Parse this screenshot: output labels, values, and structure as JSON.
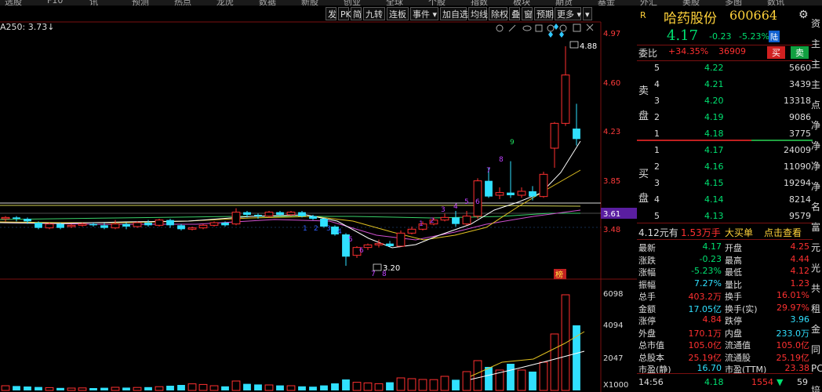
{
  "topnav": [
    "选股",
    "F10",
    "讯",
    "预测",
    "热点",
    "龙虎",
    "数据",
    "新股",
    "创业",
    "全球",
    "个股",
    "指数",
    "板块",
    "期货",
    "基金",
    "外汇",
    "美股",
    "多图",
    "数讯"
  ],
  "toolbar": [
    "发",
    "PK",
    "简",
    "九转",
    "连板",
    "事件 ▾",
    "加自选",
    "均线",
    "除权",
    "叠",
    "窗",
    "预期",
    "更多 ▾"
  ],
  "ma_label": "A250: 3.73↓",
  "price_scale": [
    "4.97",
    "4.60",
    "4.23",
    "3.85",
    "3.48"
  ],
  "volume_scale": [
    "6098",
    "4094",
    "2047",
    "X1000"
  ],
  "current_price_tag": "3.61",
  "annotations": {
    "high": "4.88",
    "low": "3.20",
    "rank_tag": "榜"
  },
  "stock": {
    "market_flag": "R",
    "name": "哈药股份",
    "code": "600664",
    "price": "4.17",
    "change": "-0.23",
    "pct": "-5.23%",
    "exchange": "陆"
  },
  "weibi": {
    "label": "委比",
    "pct": "+34.35%",
    "diff": "36909",
    "buy_btn": "买",
    "sell_btn": "卖"
  },
  "sell_side_label": [
    "卖",
    "盘"
  ],
  "buy_side_label": [
    "买",
    "盘"
  ],
  "asks": [
    {
      "level": "5",
      "price": "4.22",
      "vol": "5660"
    },
    {
      "level": "4",
      "price": "4.21",
      "vol": "3439"
    },
    {
      "level": "3",
      "price": "4.20",
      "vol": "13318"
    },
    {
      "level": "2",
      "price": "4.19",
      "vol": "9086"
    },
    {
      "level": "1",
      "price": "4.18",
      "vol": "3775"
    }
  ],
  "bids": [
    {
      "level": "1",
      "price": "4.17",
      "vol": "24009"
    },
    {
      "level": "2",
      "price": "4.16",
      "vol": "11090"
    },
    {
      "level": "3",
      "price": "4.15",
      "vol": "19294"
    },
    {
      "level": "4",
      "price": "4.14",
      "vol": "8214"
    },
    {
      "level": "5",
      "price": "4.13",
      "vol": "9579"
    }
  ],
  "big_order": {
    "price": "4.12元有",
    "amount": "1.53万手",
    "type": "大买单",
    "action": "点击查看"
  },
  "stats": [
    [
      "最新",
      "4.17",
      "开盘",
      "4.25"
    ],
    [
      "涨跌",
      "-0.23",
      "最高",
      "4.44"
    ],
    [
      "涨幅",
      "-5.23%",
      "最低",
      "4.12"
    ],
    [
      "振幅",
      "7.27%",
      "量比",
      "1.23"
    ],
    [
      "总手",
      "403.2万",
      "换手",
      "16.01%"
    ],
    [
      "金额",
      "17.05亿",
      "换手(实)",
      "29.97%"
    ],
    [
      "涨停",
      "4.84",
      "跌停",
      "3.96"
    ],
    [
      "外盘",
      "170.1万",
      "内盘",
      "233.0万"
    ],
    [
      "总市值",
      "105.0亿",
      "流通值",
      "105.0亿"
    ],
    [
      "总股本",
      "25.19亿",
      "流通股",
      "25.19亿"
    ],
    [
      "市盈(静)",
      "16.70",
      "市盈(TTM)",
      "23.38"
    ]
  ],
  "tick": {
    "time": "14:56",
    "price": "4.18",
    "vol": "1554",
    "count": "59"
  },
  "farright": [
    "资",
    "主",
    "主",
    "主",
    "点",
    "净",
    "净",
    "净",
    "净",
    "名",
    "富",
    "元",
    "光",
    "共",
    "租",
    "金",
    "同",
    "PC",
    "培"
  ],
  "chart_data": {
    "type": "candlestick",
    "price_ylim": [
      3.2,
      4.97
    ],
    "volume_ylim": [
      0,
      6098
    ],
    "candles": [
      {
        "o": 3.56,
        "c": 3.57,
        "h": 3.58,
        "l": 3.54
      },
      {
        "o": 3.57,
        "c": 3.56,
        "h": 3.58,
        "l": 3.54
      },
      {
        "o": 3.56,
        "c": 3.54,
        "h": 3.57,
        "l": 3.52
      },
      {
        "o": 3.53,
        "c": 3.49,
        "h": 3.54,
        "l": 3.48
      },
      {
        "o": 3.49,
        "c": 3.52,
        "h": 3.53,
        "l": 3.48
      },
      {
        "o": 3.52,
        "c": 3.49,
        "h": 3.53,
        "l": 3.48
      },
      {
        "o": 3.5,
        "c": 3.51,
        "h": 3.52,
        "l": 3.49
      },
      {
        "o": 3.51,
        "c": 3.52,
        "h": 3.53,
        "l": 3.5
      },
      {
        "o": 3.52,
        "c": 3.51,
        "h": 3.53,
        "l": 3.5
      },
      {
        "o": 3.51,
        "c": 3.49,
        "h": 3.53,
        "l": 3.48
      },
      {
        "o": 3.49,
        "c": 3.52,
        "h": 3.55,
        "l": 3.48
      },
      {
        "o": 3.52,
        "c": 3.5,
        "h": 3.53,
        "l": 3.48
      },
      {
        "o": 3.5,
        "c": 3.53,
        "h": 3.54,
        "l": 3.49
      },
      {
        "o": 3.53,
        "c": 3.51,
        "h": 3.55,
        "l": 3.5
      },
      {
        "o": 3.51,
        "c": 3.55,
        "h": 3.56,
        "l": 3.5
      },
      {
        "o": 3.55,
        "c": 3.51,
        "h": 3.56,
        "l": 3.49
      },
      {
        "o": 3.51,
        "c": 3.48,
        "h": 3.52,
        "l": 3.47
      },
      {
        "o": 3.48,
        "c": 3.49,
        "h": 3.5,
        "l": 3.47
      },
      {
        "o": 3.49,
        "c": 3.51,
        "h": 3.52,
        "l": 3.48
      },
      {
        "o": 3.51,
        "c": 3.53,
        "h": 3.54,
        "l": 3.5
      },
      {
        "o": 3.53,
        "c": 3.51,
        "h": 3.54,
        "l": 3.5
      },
      {
        "o": 3.52,
        "c": 3.61,
        "h": 3.64,
        "l": 3.51
      },
      {
        "o": 3.61,
        "c": 3.59,
        "h": 3.62,
        "l": 3.57
      },
      {
        "o": 3.59,
        "c": 3.58,
        "h": 3.6,
        "l": 3.56
      },
      {
        "o": 3.58,
        "c": 3.61,
        "h": 3.62,
        "l": 3.57
      },
      {
        "o": 3.61,
        "c": 3.59,
        "h": 3.62,
        "l": 3.58
      },
      {
        "o": 3.59,
        "c": 3.61,
        "h": 3.62,
        "l": 3.58
      },
      {
        "o": 3.61,
        "c": 3.58,
        "h": 3.62,
        "l": 3.57
      },
      {
        "o": 3.58,
        "c": 3.56,
        "h": 3.59,
        "l": 3.55
      },
      {
        "o": 3.56,
        "c": 3.5,
        "h": 3.57,
        "l": 3.49
      },
      {
        "o": 3.5,
        "c": 3.44,
        "h": 3.51,
        "l": 3.43
      },
      {
        "o": 3.44,
        "c": 3.27,
        "h": 3.45,
        "l": 3.2
      },
      {
        "o": 3.28,
        "c": 3.34,
        "h": 3.35,
        "l": 3.26
      },
      {
        "o": 3.34,
        "c": 3.36,
        "h": 3.37,
        "l": 3.32
      },
      {
        "o": 3.36,
        "c": 3.37,
        "h": 3.4,
        "l": 3.34
      },
      {
        "o": 3.37,
        "c": 3.35,
        "h": 3.39,
        "l": 3.34
      },
      {
        "o": 3.35,
        "c": 3.45,
        "h": 3.47,
        "l": 3.35
      },
      {
        "o": 3.45,
        "c": 3.48,
        "h": 3.5,
        "l": 3.44
      },
      {
        "o": 3.48,
        "c": 3.52,
        "h": 3.54,
        "l": 3.47
      },
      {
        "o": 3.52,
        "c": 3.55,
        "h": 3.57,
        "l": 3.51
      },
      {
        "o": 3.55,
        "c": 3.57,
        "h": 3.6,
        "l": 3.54
      },
      {
        "o": 3.57,
        "c": 3.52,
        "h": 3.62,
        "l": 3.5
      },
      {
        "o": 3.52,
        "c": 3.58,
        "h": 3.62,
        "l": 3.51
      },
      {
        "o": 3.58,
        "c": 3.85,
        "h": 3.87,
        "l": 3.56
      },
      {
        "o": 3.85,
        "c": 3.73,
        "h": 3.95,
        "l": 3.72
      },
      {
        "o": 3.74,
        "c": 3.76,
        "h": 3.8,
        "l": 3.71
      },
      {
        "o": 3.76,
        "c": 3.74,
        "h": 4.0,
        "l": 3.72
      },
      {
        "o": 3.74,
        "c": 3.77,
        "h": 3.8,
        "l": 3.72
      },
      {
        "o": 3.77,
        "c": 3.73,
        "h": 3.81,
        "l": 3.7
      },
      {
        "o": 3.73,
        "c": 3.9,
        "h": 3.92,
        "l": 3.72
      },
      {
        "o": 4.1,
        "c": 4.29,
        "h": 4.3,
        "l": 3.95
      },
      {
        "o": 4.29,
        "c": 4.66,
        "h": 4.88,
        "l": 4.27
      },
      {
        "o": 4.25,
        "c": 4.17,
        "h": 4.44,
        "l": 4.12
      }
    ],
    "volume": [
      300,
      280,
      250,
      220,
      180,
      160,
      150,
      160,
      150,
      170,
      200,
      180,
      190,
      210,
      240,
      300,
      350,
      420,
      380,
      300,
      260,
      600,
      420,
      380,
      350,
      320,
      300,
      260,
      240,
      320,
      450,
      700,
      520,
      480,
      430,
      520,
      800,
      750,
      700,
      690,
      900,
      680,
      1200,
      1900,
      1500,
      1300,
      1700,
      1300,
      1200,
      1800,
      3600,
      6098,
      4150
    ],
    "volume_up": [
      1,
      0,
      0,
      0,
      1,
      0,
      1,
      1,
      0,
      0,
      1,
      0,
      1,
      0,
      1,
      0,
      0,
      1,
      1,
      1,
      0,
      1,
      0,
      0,
      1,
      0,
      1,
      0,
      0,
      0,
      0,
      0,
      1,
      1,
      1,
      0,
      1,
      1,
      1,
      1,
      1,
      0,
      1,
      1,
      0,
      1,
      0,
      1,
      0,
      1,
      1,
      1,
      0
    ]
  }
}
